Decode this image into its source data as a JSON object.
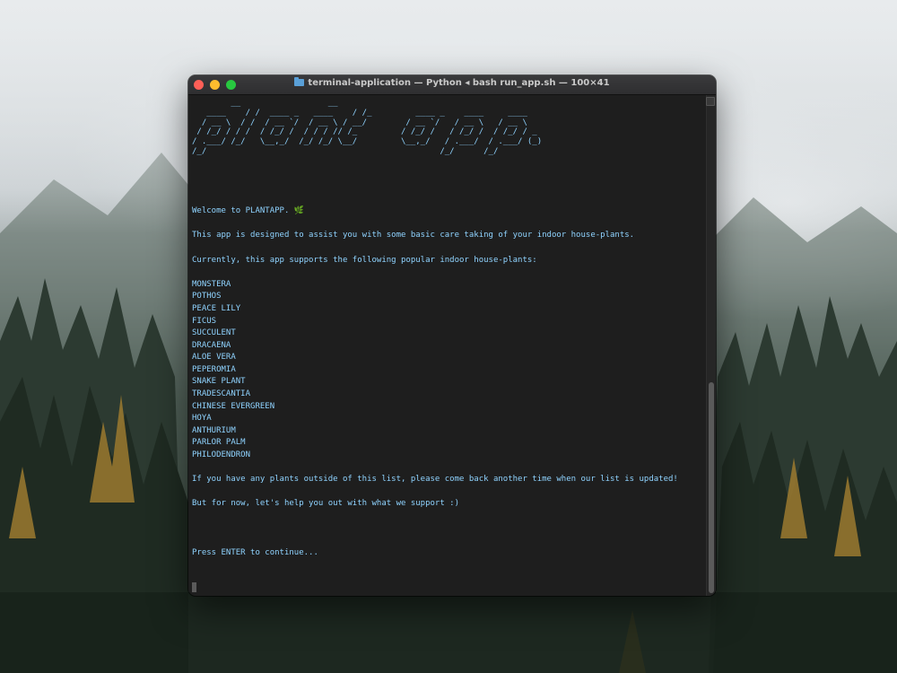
{
  "window": {
    "title": "terminal-application — Python ◂ bash run_app.sh — 100×41",
    "traffic_lights": {
      "close": "#ff5f57",
      "minimize": "#febc2e",
      "zoom": "#28c840"
    }
  },
  "terminal": {
    "text_color": "#8fd3ff",
    "ascii_logo": "        __                  __\n   ____    / /  ____ _   ____    / /_         ____ _    ____     ____\n  / __ \\  / /  / __ `/  / __ \\ / __/        / __ `/   / __ \\   / __ \\\n / /_/ / / /  / /_/ /  / / / // /_         / /_/ /   / /_/ /  / /_/ / _\n/ .___/ /_/   \\__,_/  /_/ /_/ \\__/         \\__,_/   / .___/  / .___/ (_)\n/_/                                                /_/      /_/",
    "welcome": "Welcome to PLANTAPP. 🌿",
    "intro": "This app is designed to assist you with some basic care taking of your indoor house-plants.",
    "supports": "Currently, this app supports the following popular indoor house-plants:",
    "plants": [
      "MONSTERA",
      "POTHOS",
      "PEACE LILY",
      "FICUS",
      "SUCCULENT",
      "DRACAENA",
      "ALOE VERA",
      "PEPEROMIA",
      "SNAKE PLANT",
      "TRADESCANTIA",
      "CHINESE EVERGREEN",
      "HOYA",
      "ANTHURIUM",
      "PARLOR PALM",
      "PHILODENDRON"
    ],
    "outside_list": "If you have any plants outside of this list, please come back another time when our list is updated!",
    "for_now": "But for now, let's help you out with what we support :)",
    "prompt": "Press ENTER to continue..."
  }
}
